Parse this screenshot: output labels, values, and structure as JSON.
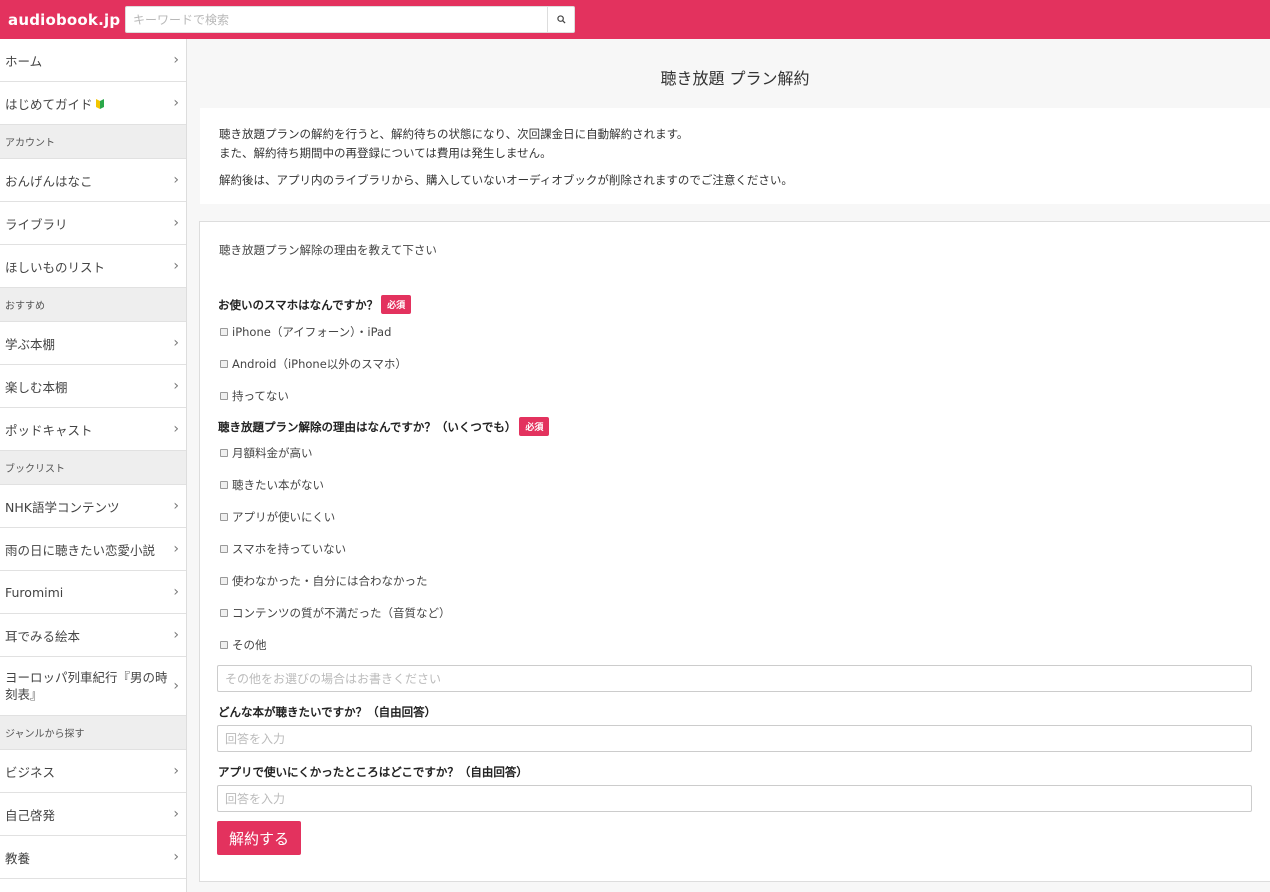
{
  "header": {
    "logo": "audiobook.jp",
    "search_placeholder": "キーワードで検索"
  },
  "sidebar": {
    "items": [
      {
        "type": "item",
        "label": "ホーム"
      },
      {
        "type": "item",
        "label": "はじめてガイド"
      },
      {
        "type": "header",
        "label": "アカウント"
      },
      {
        "type": "item",
        "label": "おんげんはなこ"
      },
      {
        "type": "item",
        "label": "ライブラリ"
      },
      {
        "type": "item",
        "label": "ほしいものリスト"
      },
      {
        "type": "header",
        "label": "おすすめ"
      },
      {
        "type": "item",
        "label": "学ぶ本棚"
      },
      {
        "type": "item",
        "label": "楽しむ本棚"
      },
      {
        "type": "item",
        "label": "ポッドキャスト"
      },
      {
        "type": "header",
        "label": "ブックリスト"
      },
      {
        "type": "item",
        "label": "NHK語学コンテンツ"
      },
      {
        "type": "item",
        "label": "雨の日に聴きたい恋愛小説"
      },
      {
        "type": "item",
        "label": "Furomimi"
      },
      {
        "type": "item",
        "label": "耳でみる絵本"
      },
      {
        "type": "item",
        "label": "ヨーロッパ列車紀行『男の時刻表』"
      },
      {
        "type": "header",
        "label": "ジャンルから探す"
      },
      {
        "type": "item",
        "label": "ビジネス"
      },
      {
        "type": "item",
        "label": "自己啓発"
      },
      {
        "type": "item",
        "label": "教養"
      }
    ]
  },
  "main": {
    "title": "聴き放題 プラン解約",
    "notice": {
      "line1": "聴き放題プランの解約を行うと、解約待ちの状態になり、次回課金日に自動解約されます。",
      "line2": "また、解約待ち期間中の再登録については費用は発生しません。",
      "line3": "解約後は、アプリ内のライブラリから、購入していないオーディオブックが削除されますのでご注意ください。"
    },
    "form": {
      "intro": "聴き放題プラン解除の理由を教えて下さい",
      "required_badge": "必須",
      "q1": {
        "title": "お使いのスマホはなんですか？",
        "options": [
          "iPhone（アイフォーン）・iPad",
          "Android（iPhone以外のスマホ）",
          "持ってない"
        ]
      },
      "q2": {
        "title": "聴き放題プラン解除の理由はなんですか？（いくつでも）",
        "options": [
          "月額料金が高い",
          "聴きたい本がない",
          "アプリが使いにくい",
          "スマホを持っていない",
          "使わなかった・自分には合わなかった",
          "コンテンツの質が不満だった（音質など）",
          "その他"
        ],
        "other_placeholder": "その他をお選びの場合はお書きください"
      },
      "q3": {
        "title": "どんな本が聴きたいですか？（自由回答）",
        "placeholder": "回答を入力"
      },
      "q4": {
        "title": "アプリで使いにくかったところはどこですか？（自由回答）",
        "placeholder": "回答を入力"
      },
      "submit_label": "解約する"
    }
  }
}
